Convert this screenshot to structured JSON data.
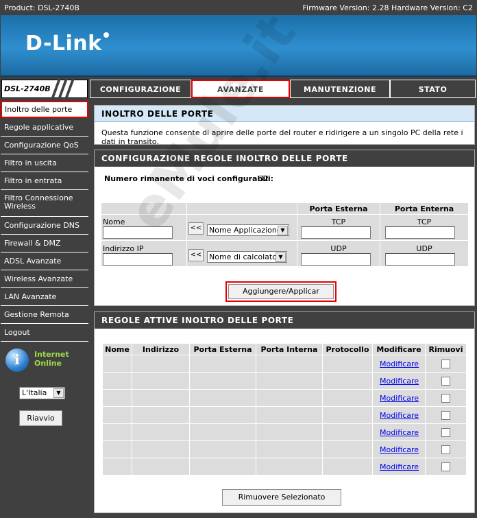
{
  "topbar": {
    "product": "Product: DSL-2740B",
    "firmware": "Firmware Version: 2.28 Hardware Version: C2"
  },
  "brand": {
    "logo": "D-Link"
  },
  "nav": {
    "model": "DSL-2740B",
    "tabs": [
      "CONFIGURAZIONE",
      "AVANZATE",
      "MANUTENZIONE",
      "STATO"
    ]
  },
  "sidebar": {
    "items": [
      "Inoltro delle porte",
      "Regole applicative",
      "Configurazione QoS",
      "Filtro in uscita",
      "Filtro in entrata",
      "Filtro Connessione Wireless",
      "Configurazione DNS",
      "Firewall & DMZ",
      "ADSL Avanzate",
      "Wireless Avanzate",
      "LAN Avanzate",
      "Gestione Remota",
      "Logout"
    ],
    "internet_line1": "Internet",
    "internet_line2": "Online",
    "language": "L'Italia",
    "reboot": "Riavvio"
  },
  "intro": {
    "title": "INOLTRO DELLE PORTE",
    "text": "Questa funzione consente di aprire delle porte del router e ridirigere a un singolo PC della rete i dati in transito."
  },
  "config": {
    "title": "CONFIGURAZIONE REGOLE INOLTRO DELLE PORTE",
    "remaining_label": "Numero rimanente di voci configurabili:",
    "remaining_value": "32",
    "col_external": "Porta Esterna",
    "col_internal": "Porta Enterna",
    "name_label": "Nome",
    "ip_label": "Indirizzo IP",
    "arrow": "<<",
    "app_select": "Nome Applicazione",
    "pc_select": "Nome di calcolatore",
    "tcp": "TCP",
    "udp": "UDP",
    "apply": "Aggiungere/Applicar"
  },
  "active": {
    "title": "REGOLE ATTIVE INOLTRO DELLE PORTE",
    "headers": [
      "Nome",
      "Indirizzo",
      "Porta Esterna",
      "Porta Interna",
      "Protocollo",
      "Modificare",
      "Rimuovi"
    ],
    "edit_link": "Modificare",
    "remove_button": "Rimuovere Selezionato"
  },
  "watermark": "eMule.it",
  "colors": {
    "accent_red": "#e60000",
    "header_dark": "#404040",
    "banner_blue": "#2f8fcf"
  }
}
